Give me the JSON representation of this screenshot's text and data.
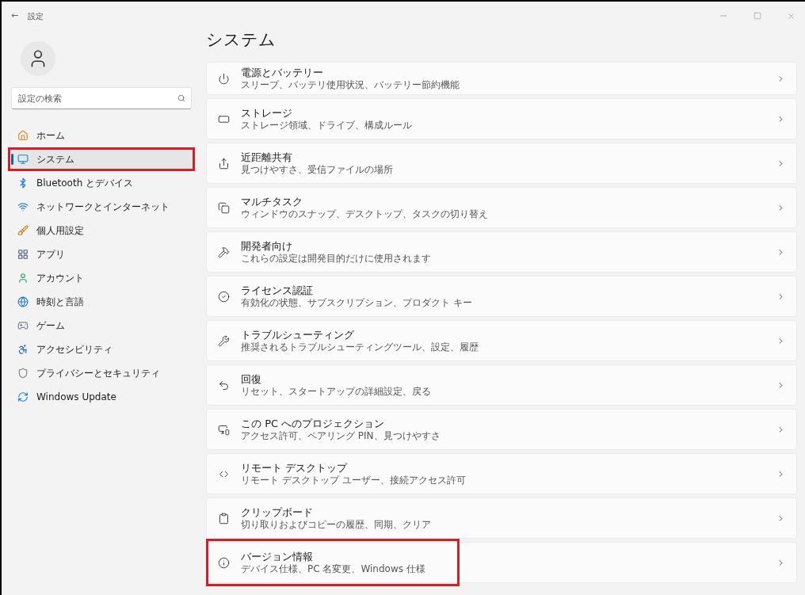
{
  "window": {
    "title": "設定",
    "back": "←"
  },
  "sidebar": {
    "search": {
      "placeholder": "設定の検索"
    },
    "items": [
      {
        "label": "ホーム",
        "selected": false,
        "highlighted": false
      },
      {
        "label": "システム",
        "selected": true,
        "highlighted": true
      },
      {
        "label": "Bluetooth とデバイス",
        "selected": false,
        "highlighted": false
      },
      {
        "label": "ネットワークとインターネット",
        "selected": false,
        "highlighted": false
      },
      {
        "label": "個人用設定",
        "selected": false,
        "highlighted": false
      },
      {
        "label": "アプリ",
        "selected": false,
        "highlighted": false
      },
      {
        "label": "アカウント",
        "selected": false,
        "highlighted": false
      },
      {
        "label": "時刻と言語",
        "selected": false,
        "highlighted": false
      },
      {
        "label": "ゲーム",
        "selected": false,
        "highlighted": false
      },
      {
        "label": "アクセシビリティ",
        "selected": false,
        "highlighted": false
      },
      {
        "label": "プライバシーとセキュリティ",
        "selected": false,
        "highlighted": false
      },
      {
        "label": "Windows Update",
        "selected": false,
        "highlighted": false
      }
    ]
  },
  "page": {
    "title": "システム",
    "settings": [
      {
        "title": "電源とバッテリー",
        "subtitle": "スリープ、バッテリ使用状況、バッテリー節約機能",
        "highlighted": false
      },
      {
        "title": "ストレージ",
        "subtitle": "ストレージ領域、ドライブ、構成ルール",
        "highlighted": false
      },
      {
        "title": "近距離共有",
        "subtitle": "見つけやすさ、受信ファイルの場所",
        "highlighted": false
      },
      {
        "title": "マルチタスク",
        "subtitle": "ウィンドウのスナップ、デスクトップ、タスクの切り替え",
        "highlighted": false
      },
      {
        "title": "開発者向け",
        "subtitle": "これらの設定は開発目的だけに使用されます",
        "highlighted": false
      },
      {
        "title": "ライセンス認証",
        "subtitle": "有効化の状態、サブスクリプション、プロダクト キー",
        "highlighted": false
      },
      {
        "title": "トラブルシューティング",
        "subtitle": "推奨されるトラブルシューティングツール、設定、履歴",
        "highlighted": false
      },
      {
        "title": "回復",
        "subtitle": "リセット、スタートアップの詳細設定、戻る",
        "highlighted": false
      },
      {
        "title": "この PC へのプロジェクション",
        "subtitle": "アクセス許可、ペアリング PIN、見つけやすさ",
        "highlighted": false
      },
      {
        "title": "リモート デスクトップ",
        "subtitle": "リモート デスクトップ ユーザー、接続アクセス許可",
        "highlighted": false
      },
      {
        "title": "クリップボード",
        "subtitle": "切り取りおよびコピーの履歴、同期、クリア",
        "highlighted": false
      },
      {
        "title": "バージョン情報",
        "subtitle": "デバイス仕様、PC 名変更、Windows 仕様",
        "highlighted": true
      }
    ]
  }
}
